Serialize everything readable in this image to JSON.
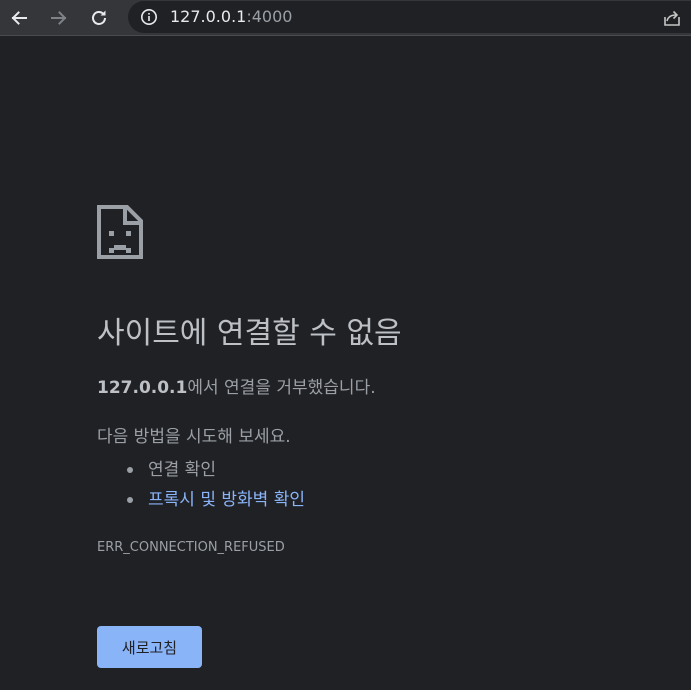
{
  "browser": {
    "url_host": "127.0.0.1",
    "url_port": ":4000",
    "icons": {
      "back": "arrow-left-icon",
      "forward": "arrow-right-icon",
      "reload": "reload-icon",
      "site_info": "info-icon",
      "share": "share-icon"
    }
  },
  "error_page": {
    "icon": "sad-document-icon",
    "title": "사이트에 연결할 수 없음",
    "detail_host": "127.0.0.1",
    "detail_suffix": "에서 연결을 거부했습니다.",
    "suggestions_heading": "다음 방법을 시도해 보세요.",
    "suggestions": [
      {
        "label": "연결 확인",
        "is_link": false
      },
      {
        "label": "프록시 및 방화벽 확인",
        "is_link": true
      }
    ],
    "error_code": "ERR_CONNECTION_REFUSED",
    "reload_label": "새로고침"
  },
  "colors": {
    "background": "#202124",
    "toolbar": "#35363a",
    "title_text": "#bdc1c6",
    "body_text": "#9aa0a6",
    "link": "#8ab4f8",
    "button_bg": "#8ab4f8"
  }
}
